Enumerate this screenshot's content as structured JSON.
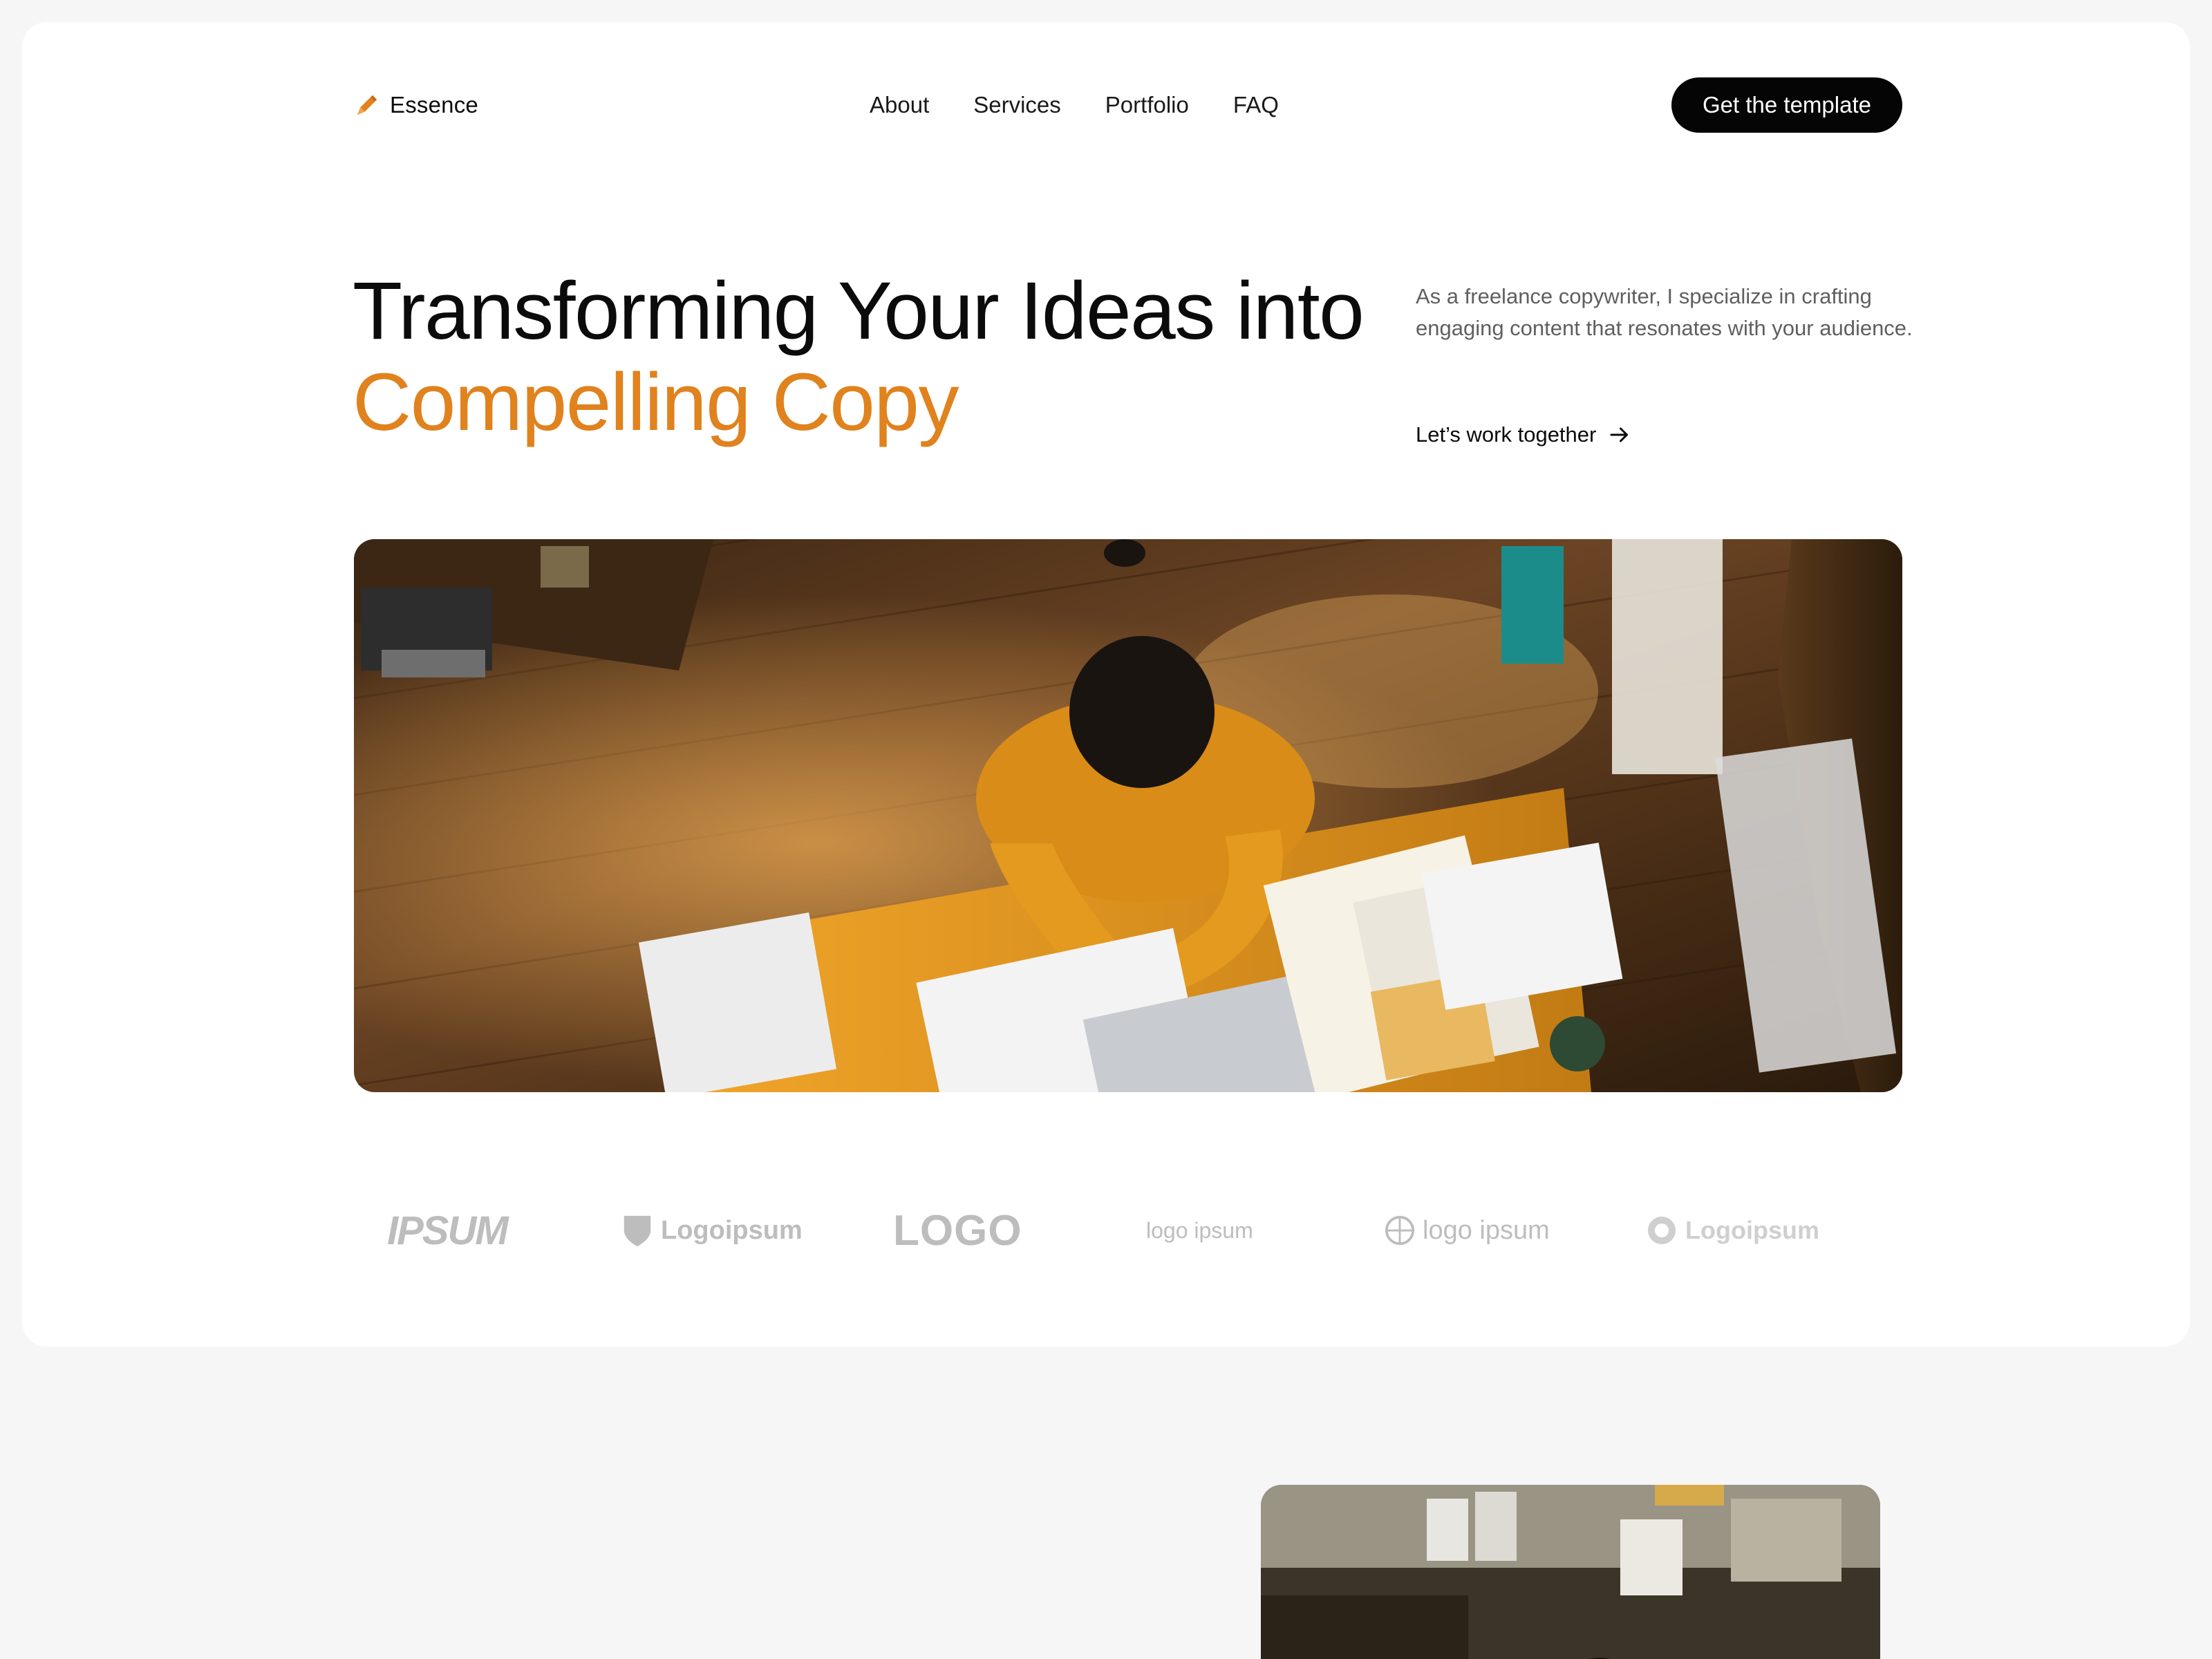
{
  "nav": {
    "brand": "Essence",
    "brand_icon": "pen-nib-icon",
    "items": [
      "About",
      "Services",
      "Portfolio",
      "FAQ"
    ],
    "cta_label": "Get the template"
  },
  "hero": {
    "title_line1": "Transforming Your Ideas into",
    "title_line2": "Compelling Copy",
    "description": "As a freelance copywriter, I specialize in crafting engaging content that resonates with your audience.",
    "link_label": "Let’s work together"
  },
  "logos": [
    "IPSUM",
    "Logoipsum",
    "LOGO",
    "logo ipsum",
    "logo ipsum",
    "Logoipsum"
  ],
  "colors": {
    "accent": "#e0821e",
    "text": "#0b0b0b",
    "muted": "#5f5f5f",
    "background": "#f6f6f6",
    "card": "#ffffff",
    "logo_gray": "#bdbdbd"
  }
}
